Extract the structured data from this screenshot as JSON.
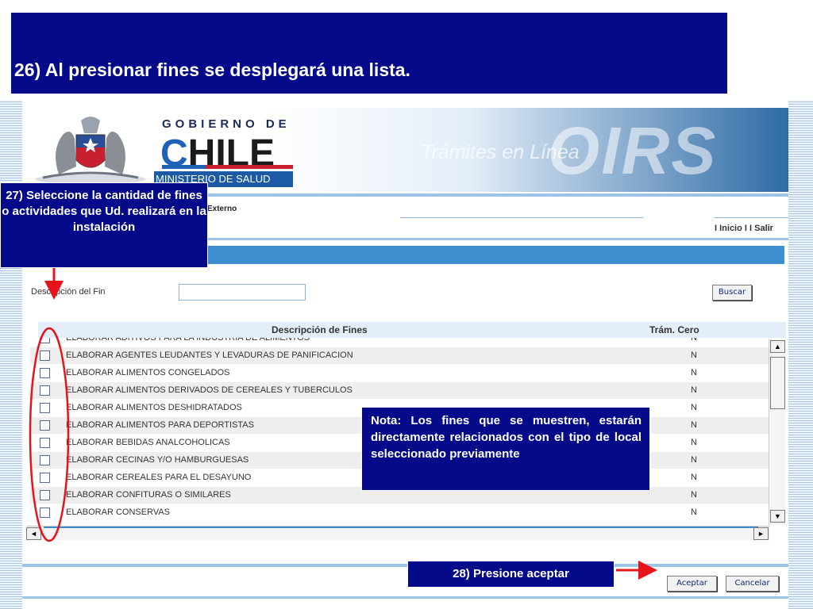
{
  "slide": {
    "title": "26) Al presionar fines se desplegará una lista."
  },
  "header": {
    "gobierno_label": "GOBIERNO DE",
    "chile_c": "C",
    "chile_rest": "HILE",
    "ministry": "MINISTERIO DE SALUD",
    "tramites": "Trámites en Línea",
    "oirs": "OIRS"
  },
  "topbar": {
    "externo": "Externo",
    "nav_links": "I Inicio I I Salir"
  },
  "search": {
    "label": "Descripción del Fin",
    "value": "",
    "button": "Buscar"
  },
  "table": {
    "col_description": "Descripción de Fines",
    "col_tram_cero": "Trám. Cero",
    "rows": [
      {
        "label": "ELABORAR ADITIVOS PARA LA INDUSTRIA DE ALIMENTOS",
        "flag": "N"
      },
      {
        "label": "ELABORAR AGENTES LEUDANTES Y LEVADURAS DE PANIFICACION",
        "flag": "N"
      },
      {
        "label": "ELABORAR ALIMENTOS CONGELADOS",
        "flag": "N"
      },
      {
        "label": "ELABORAR ALIMENTOS DERIVADOS DE CEREALES Y TUBERCULOS",
        "flag": "N"
      },
      {
        "label": "ELABORAR ALIMENTOS DESHIDRATADOS",
        "flag": "N"
      },
      {
        "label": "ELABORAR ALIMENTOS PARA DEPORTISTAS",
        "flag": "N"
      },
      {
        "label": "ELABORAR BEBIDAS ANALCOHOLICAS",
        "flag": "N"
      },
      {
        "label": "ELABORAR CECINAS Y/O HAMBURGUESAS",
        "flag": "N"
      },
      {
        "label": "ELABORAR CEREALES PARA EL DESAYUNO",
        "flag": "N"
      },
      {
        "label": "ELABORAR CONFITURAS O SIMILARES",
        "flag": "N"
      },
      {
        "label": "ELABORAR CONSERVAS",
        "flag": "N"
      }
    ]
  },
  "scrollbar": {
    "up": "▲",
    "down": "▼",
    "left": "◄",
    "right": "►"
  },
  "actions": {
    "accept": "Aceptar",
    "cancel": "Cancelar"
  },
  "callouts": {
    "step27": "27) Seleccione la cantidad de fines o actividades que Ud. realizará en la instalación",
    "note": "Nota:  Los fines que se muestren, estarán directamente relacionados con el tipo de local seleccionado previamente",
    "step28": "28) Presione aceptar"
  },
  "colors": {
    "banner": "#050a8a",
    "section_bar": "#3d8fd0",
    "annotation": "#e8141c"
  }
}
